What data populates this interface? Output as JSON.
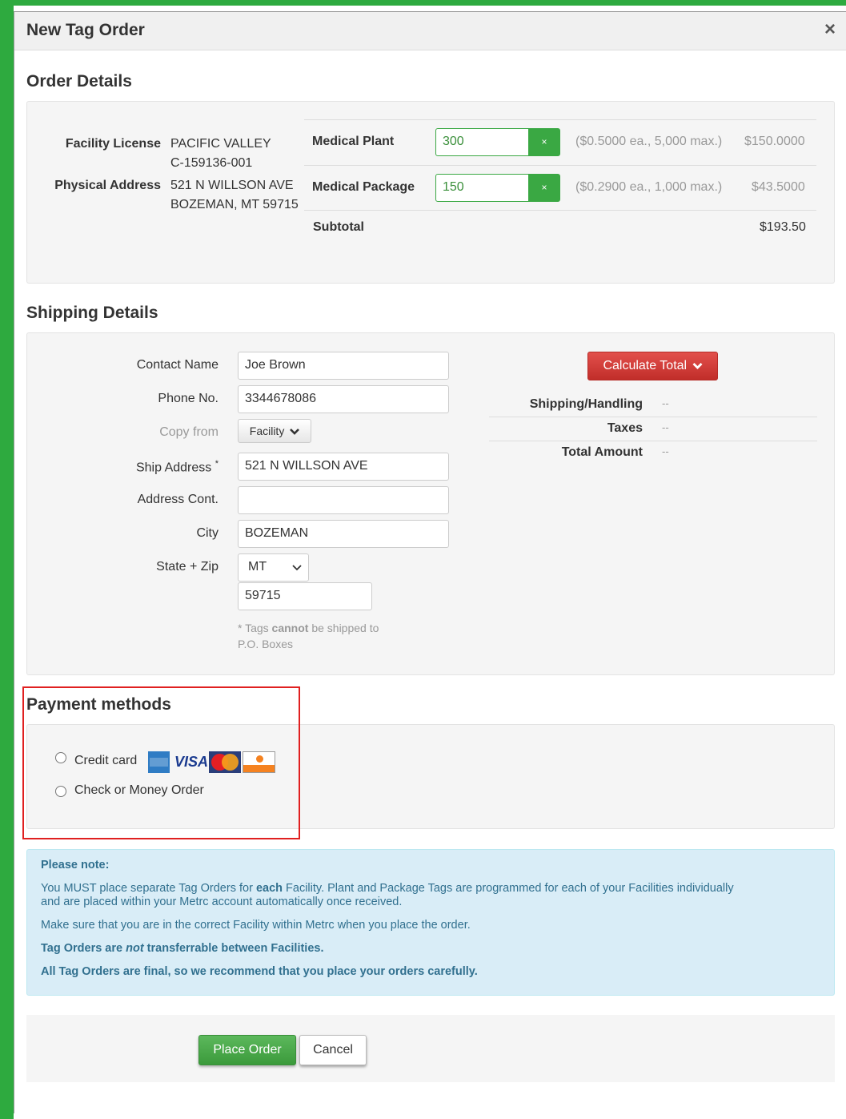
{
  "modal": {
    "title": "New Tag Order",
    "close_label": "×"
  },
  "order_details": {
    "title": "Order Details",
    "facility_license_label": "Facility License",
    "facility_name": "PACIFIC VALLEY",
    "facility_license": "C-159136-001",
    "physical_address_label": "Physical Address",
    "address_line1": "521 N WILLSON AVE",
    "address_line2": "BOZEMAN, MT 59715",
    "items": [
      {
        "label": "Medical Plant",
        "quantity": "300",
        "clear_label": "×",
        "price_info": "($0.5000 ea., 5,000 max.)",
        "total": "$150.0000"
      },
      {
        "label": "Medical Package",
        "quantity": "150",
        "clear_label": "×",
        "price_info": "($0.2900 ea., 1,000 max.)",
        "total": "$43.5000"
      }
    ],
    "subtotal_label": "Subtotal",
    "subtotal": "$193.50"
  },
  "shipping": {
    "title": "Shipping Details",
    "contact_name_label": "Contact Name",
    "contact_name": "Joe Brown",
    "phone_label": "Phone No.",
    "phone": "3344678086",
    "copy_from_label": "Copy from",
    "copy_from_button": "Facility",
    "ship_address_label": "Ship Address",
    "required_mark": "*",
    "ship_address": "521 N WILLSON AVE",
    "address_cont_label": "Address Cont.",
    "address_cont": "",
    "city_label": "City",
    "city": "BOZEMAN",
    "state_zip_label": "State + Zip",
    "state": "MT",
    "zip": "59715",
    "note_prefix": "* Tags ",
    "note_bold": "cannot",
    "note_suffix": " be shipped to",
    "note_line2": "P.O. Boxes",
    "calculate_button": "Calculate Total",
    "shipping_handling_label": "Shipping/Handling",
    "shipping_handling_value": "--",
    "taxes_label": "Taxes",
    "taxes_value": "--",
    "total_amount_label": "Total Amount",
    "total_amount_value": "--"
  },
  "payment": {
    "title": "Payment methods",
    "credit_card_label": "Credit card",
    "check_label": "Check or Money Order",
    "card_logos": [
      "AMERICAN EXPRESS",
      "VISA",
      "MasterCard",
      "DISCOVER"
    ]
  },
  "note": {
    "heading": "Please note:",
    "p1_pre": "You MUST place separate Tag Orders for ",
    "p1_bold": "each",
    "p1_post": " Facility. Plant and Package Tags are programmed for each of your Facilities individually",
    "p1_line2": "and are placed within your Metrc account automatically once received.",
    "p2": "Make sure that you are in the correct Facility within Metrc when you place the order.",
    "p3_pre": "Tag Orders are ",
    "p3_em": "not",
    "p3_post": " transferrable between Facilities.",
    "p4": "All Tag Orders are final, so we recommend that you place your orders carefully."
  },
  "footer": {
    "place_order": "Place Order",
    "cancel": "Cancel"
  },
  "colors": {
    "frame_green": "#2eaa3f",
    "accent_green": "#3aa843",
    "danger_red": "#d9403b",
    "highlight_red": "#e02020",
    "info_bg": "#d9edf7",
    "info_text": "#31708f"
  }
}
